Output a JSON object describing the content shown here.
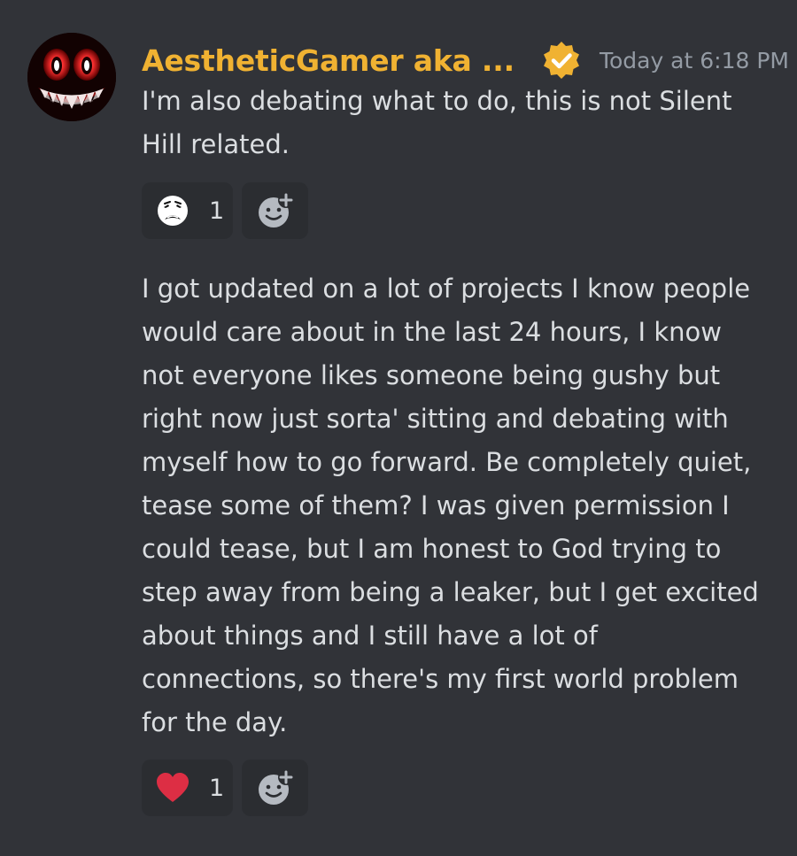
{
  "author": {
    "name": "AestheticGamer aka ...",
    "timestamp": "Today at 6:18 PM",
    "avatar_icon": "smiling-demon-face-icon",
    "badge_icon": "verified-check-badge-icon",
    "name_color": "#f0b232"
  },
  "messages": [
    {
      "text": "I'm also debating what to do, this is not Silent\nHill related.",
      "reactions": [
        {
          "emoji": "tired-face-emoji",
          "count": "1"
        }
      ],
      "add_reaction_icon": "add-reaction-icon"
    },
    {
      "text": "I got updated on a lot of projects I know people\nwould care about in the last 24 hours, I know\nnot everyone likes someone being gushy but\nright now just sorta' sitting and debating with\nmyself how to go forward. Be completely quiet,\ntease some of them? I was given permission I\ncould tease, but I am honest to God trying to\nstep away from being a leaker, but I get excited\nabout things and I still have a lot of\nconnections, so there's my first world problem\nfor the day.",
      "reactions": [
        {
          "emoji": "red-heart-emoji",
          "count": "1"
        }
      ],
      "add_reaction_icon": "add-reaction-icon"
    }
  ],
  "colors": {
    "background": "#313338",
    "reaction_bg": "#2b2d31",
    "text": "#dbdee1",
    "timestamp": "#949ba4",
    "heart": "#dd2e44"
  }
}
